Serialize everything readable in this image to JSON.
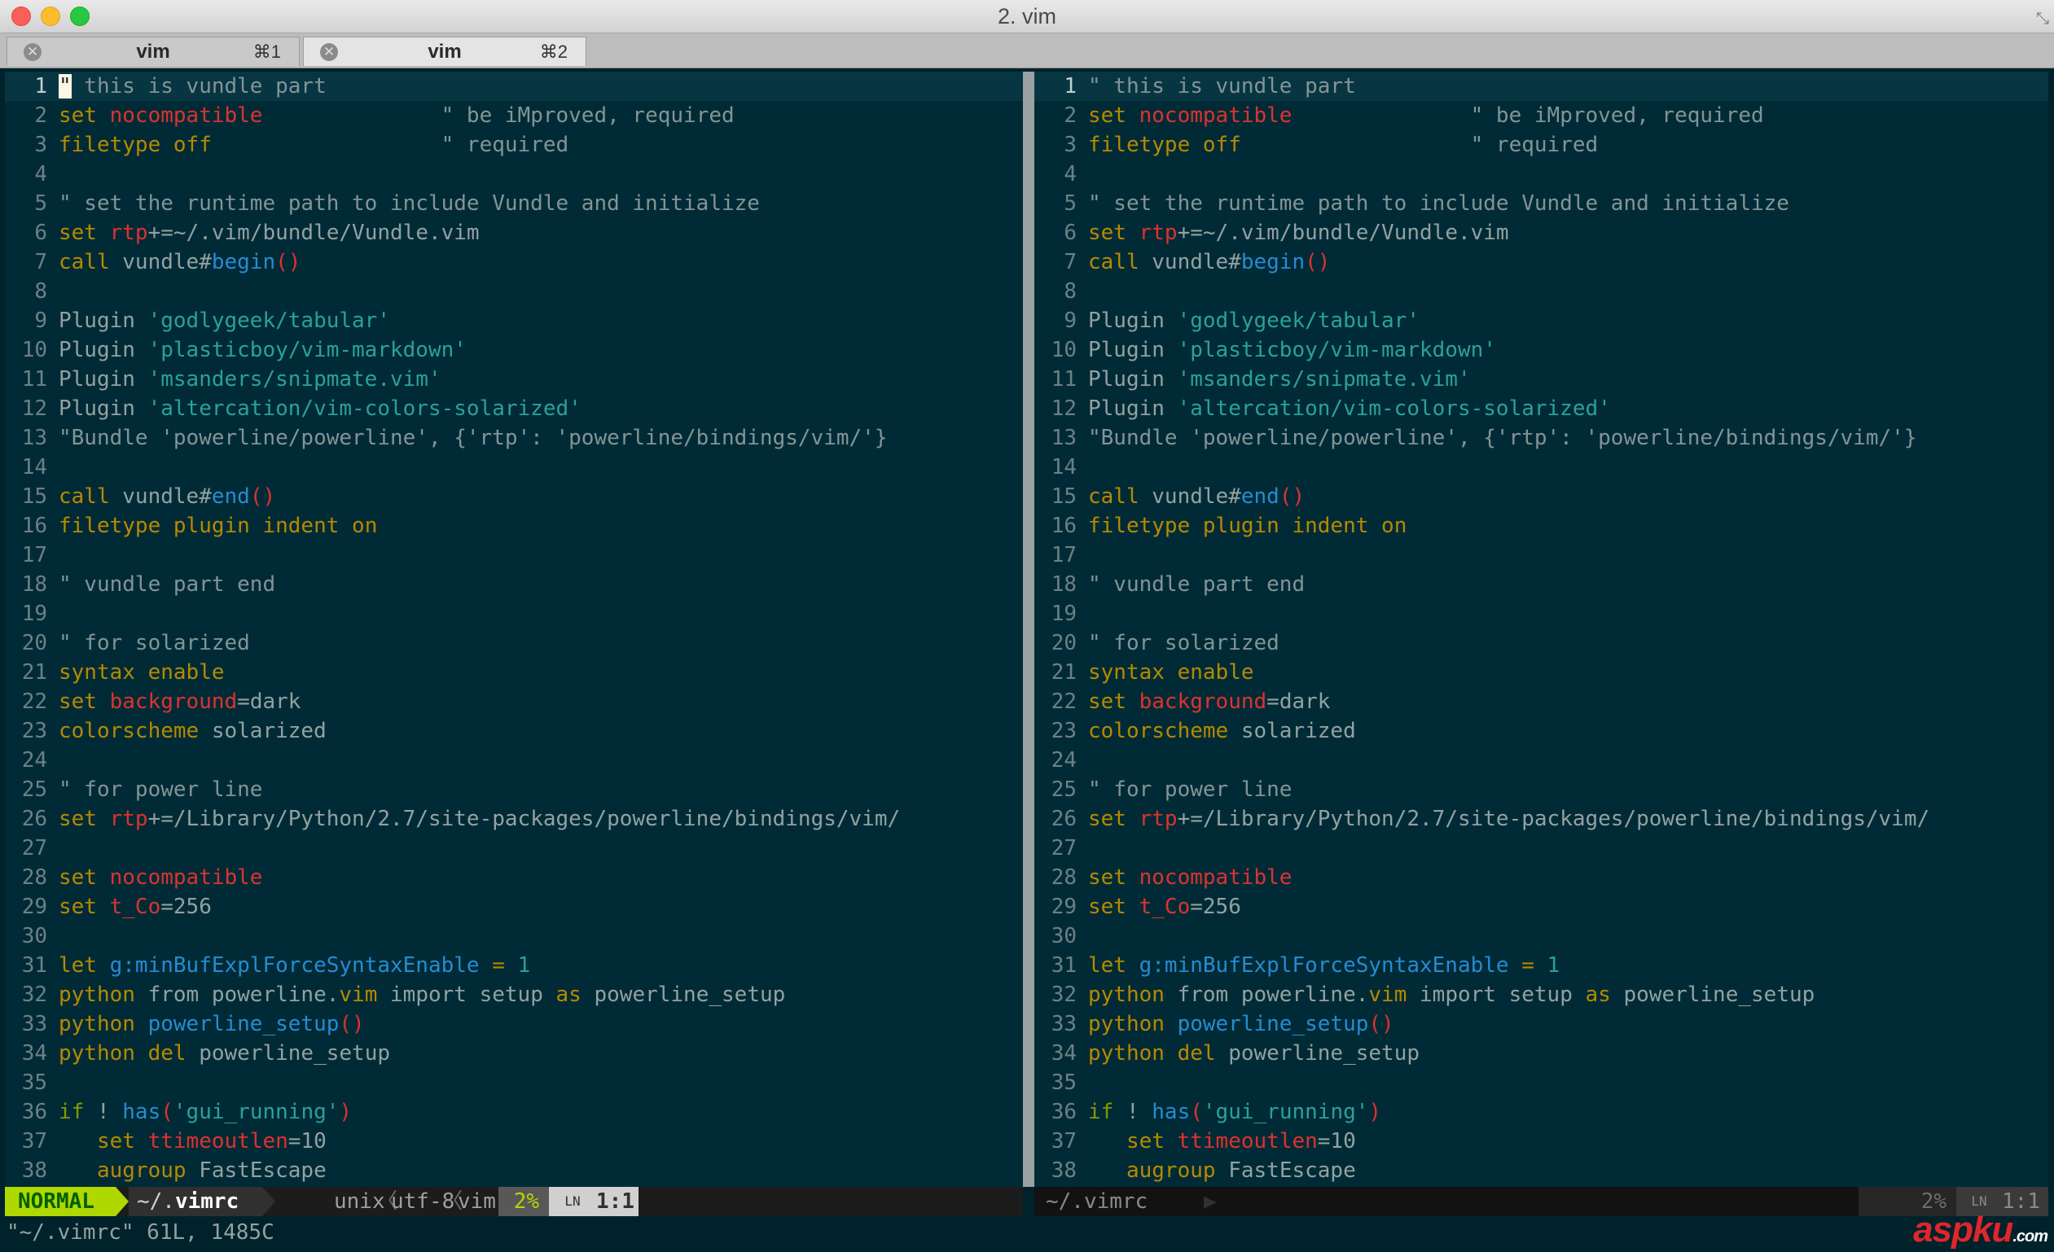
{
  "window": {
    "title": "2. vim"
  },
  "tabs": [
    {
      "label": "vim",
      "shortcut": "⌘1"
    },
    {
      "label": "vim",
      "shortcut": "⌘2"
    }
  ],
  "colors": {
    "background": "#002b36",
    "keyword": "#b58900",
    "comment": "#839496",
    "option": "#dc322f",
    "string": "#2aa198",
    "function": "#268bd2",
    "mode_normal": "#afd700"
  },
  "editor": {
    "cursor_line": 1,
    "lines": [
      [
        [
          "c",
          "\" this is vundle part"
        ]
      ],
      [
        [
          "k",
          "set "
        ],
        [
          "r",
          "nocompatible"
        ],
        [
          "t",
          "              "
        ],
        [
          "c",
          "\" be iMproved, required"
        ]
      ],
      [
        [
          "k",
          "filetype "
        ],
        [
          "k",
          "off"
        ],
        [
          "t",
          "                  "
        ],
        [
          "c",
          "\" required"
        ]
      ],
      [],
      [
        [
          "c",
          "\" set the runtime path to include Vundle and initialize"
        ]
      ],
      [
        [
          "k",
          "set "
        ],
        [
          "r",
          "rtp"
        ],
        [
          "t",
          "+=~/.vim/bundle/Vundle.vim"
        ]
      ],
      [
        [
          "k",
          "call "
        ],
        [
          "t",
          "vundle#"
        ],
        [
          "b",
          "begin"
        ],
        [
          "r",
          "()"
        ]
      ],
      [],
      [
        [
          "t",
          "Plugin "
        ],
        [
          "s",
          "'godlygeek/tabular'"
        ]
      ],
      [
        [
          "t",
          "Plugin "
        ],
        [
          "s",
          "'plasticboy/vim-markdown'"
        ]
      ],
      [
        [
          "t",
          "Plugin "
        ],
        [
          "s",
          "'msanders/snipmate.vim'"
        ]
      ],
      [
        [
          "t",
          "Plugin "
        ],
        [
          "s",
          "'altercation/vim-colors-solarized'"
        ]
      ],
      [
        [
          "c",
          "\"Bundle 'powerline/powerline', {'rtp': 'powerline/bindings/vim/'}"
        ]
      ],
      [],
      [
        [
          "k",
          "call "
        ],
        [
          "t",
          "vundle#"
        ],
        [
          "b",
          "end"
        ],
        [
          "r",
          "()"
        ]
      ],
      [
        [
          "k",
          "filetype "
        ],
        [
          "k",
          "plugin "
        ],
        [
          "k",
          "indent "
        ],
        [
          "k",
          "on"
        ]
      ],
      [],
      [
        [
          "c",
          "\" vundle part end"
        ]
      ],
      [],
      [
        [
          "c",
          "\" for solarized"
        ]
      ],
      [
        [
          "k",
          "syntax "
        ],
        [
          "k",
          "enable"
        ]
      ],
      [
        [
          "k",
          "set "
        ],
        [
          "r",
          "background"
        ],
        [
          "t",
          "=dark"
        ]
      ],
      [
        [
          "k",
          "colorscheme "
        ],
        [
          "t",
          "solarized"
        ]
      ],
      [],
      [
        [
          "c",
          "\" for power line"
        ]
      ],
      [
        [
          "k",
          "set "
        ],
        [
          "r",
          "rtp"
        ],
        [
          "t",
          "+=/Library/Python/2.7/site-packages/powerline/bindings/vim/"
        ]
      ],
      [],
      [
        [
          "k",
          "set "
        ],
        [
          "r",
          "nocompatible"
        ]
      ],
      [
        [
          "k",
          "set "
        ],
        [
          "r",
          "t_Co"
        ],
        [
          "t",
          "=256"
        ]
      ],
      [],
      [
        [
          "k",
          "let "
        ],
        [
          "b",
          "g:minBufExplForceSyntaxEnable"
        ],
        [
          "t",
          " "
        ],
        [
          "k",
          "="
        ],
        [
          "t",
          " "
        ],
        [
          "s",
          "1"
        ]
      ],
      [
        [
          "k",
          "python "
        ],
        [
          "t",
          "from powerline."
        ],
        [
          "k",
          "vim"
        ],
        [
          "t",
          " import setup "
        ],
        [
          "k",
          "as"
        ],
        [
          "t",
          " powerline_setup"
        ]
      ],
      [
        [
          "k",
          "python "
        ],
        [
          "b",
          "powerline_setup"
        ],
        [
          "r",
          "()"
        ]
      ],
      [
        [
          "k",
          "python "
        ],
        [
          "k",
          "del"
        ],
        [
          "t",
          " powerline_setup"
        ]
      ],
      [],
      [
        [
          "g",
          "if"
        ],
        [
          "t",
          " ! "
        ],
        [
          "b",
          "has"
        ],
        [
          "r",
          "("
        ],
        [
          "s",
          "'gui_running'"
        ],
        [
          "r",
          ")"
        ]
      ],
      [
        [
          "t",
          "   "
        ],
        [
          "k",
          "set "
        ],
        [
          "r",
          "ttimeoutlen"
        ],
        [
          "t",
          "=10"
        ]
      ],
      [
        [
          "t",
          "   "
        ],
        [
          "k",
          "augroup "
        ],
        [
          "t",
          "FastEscape"
        ]
      ]
    ]
  },
  "status_left": {
    "mode": "NORMAL",
    "file_prefix": "~/.",
    "file_name": "vimrc",
    "fileformat": "unix",
    "encoding": "utf-8",
    "filetype": "vim",
    "percent": "2%",
    "ln_glyph": "LN",
    "position": "1:1"
  },
  "status_right": {
    "file": "~/.vimrc",
    "percent": "2%",
    "ln_glyph": "LN",
    "position": "1:1"
  },
  "command_line": "\"~/.vimrc\" 61L, 1485C",
  "watermark": {
    "brand": "aspku",
    "suffix": ".com"
  }
}
